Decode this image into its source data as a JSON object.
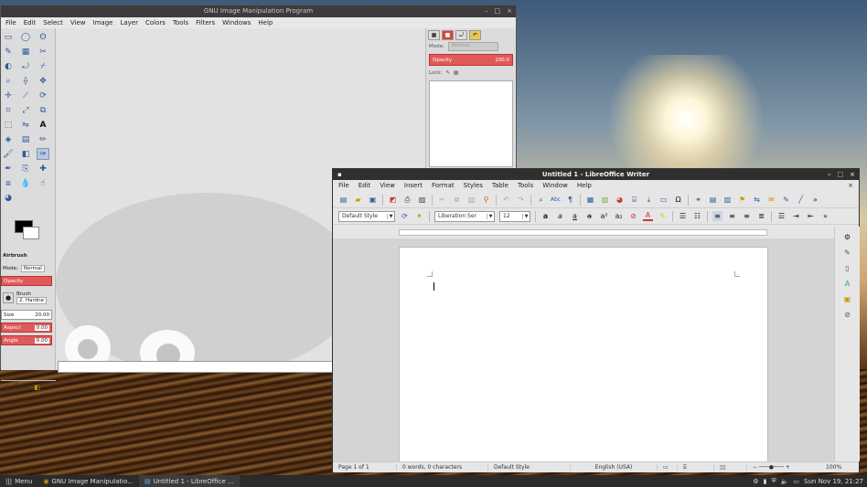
{
  "gimp": {
    "title": "GNU Image Manipulation Program",
    "controls": [
      "–",
      "□",
      "×"
    ],
    "menu": [
      "File",
      "Edit",
      "Select",
      "View",
      "Image",
      "Layer",
      "Colors",
      "Tools",
      "Filters",
      "Windows",
      "Help"
    ],
    "tool_options": {
      "title": "Airbrush",
      "mode_label": "Mode:",
      "mode_value": "Normal",
      "opacity_label": "Opacity",
      "brush_label": "Brush",
      "brush_value": "2. Hardne",
      "size_label": "Size",
      "size_value": "20.00",
      "aspect_label": "Aspect",
      "aspect_value": "0.00",
      "angle_label": "Angle",
      "angle_value": "0.00"
    },
    "layers": {
      "mode_label": "Mode:",
      "mode_value": "Normal",
      "opacity_label": "Opacity",
      "opacity_value": "100.0",
      "lock_label": "Lock:"
    }
  },
  "writer": {
    "title": "Untitled 1 - LibreOffice Writer",
    "controls": [
      "–",
      "□",
      "×"
    ],
    "menu": [
      "File",
      "Edit",
      "View",
      "Insert",
      "Format",
      "Styles",
      "Table",
      "Tools",
      "Window",
      "Help"
    ],
    "paragraph_style": "Default Style",
    "font_name": "Liberation Ser",
    "font_size": "12",
    "status": {
      "page": "Page 1 of 1",
      "words": "0 words, 0 characters",
      "style": "Default Style",
      "language": "English (USA)",
      "zoom": "100%"
    }
  },
  "taskbar": {
    "menu_label": "Menu",
    "gimp_task": "GNU Image Manipulatio...",
    "writer_task": "Untitled 1 - LibreOffice ...",
    "clock": "Sun Nov 19, 21:27"
  }
}
